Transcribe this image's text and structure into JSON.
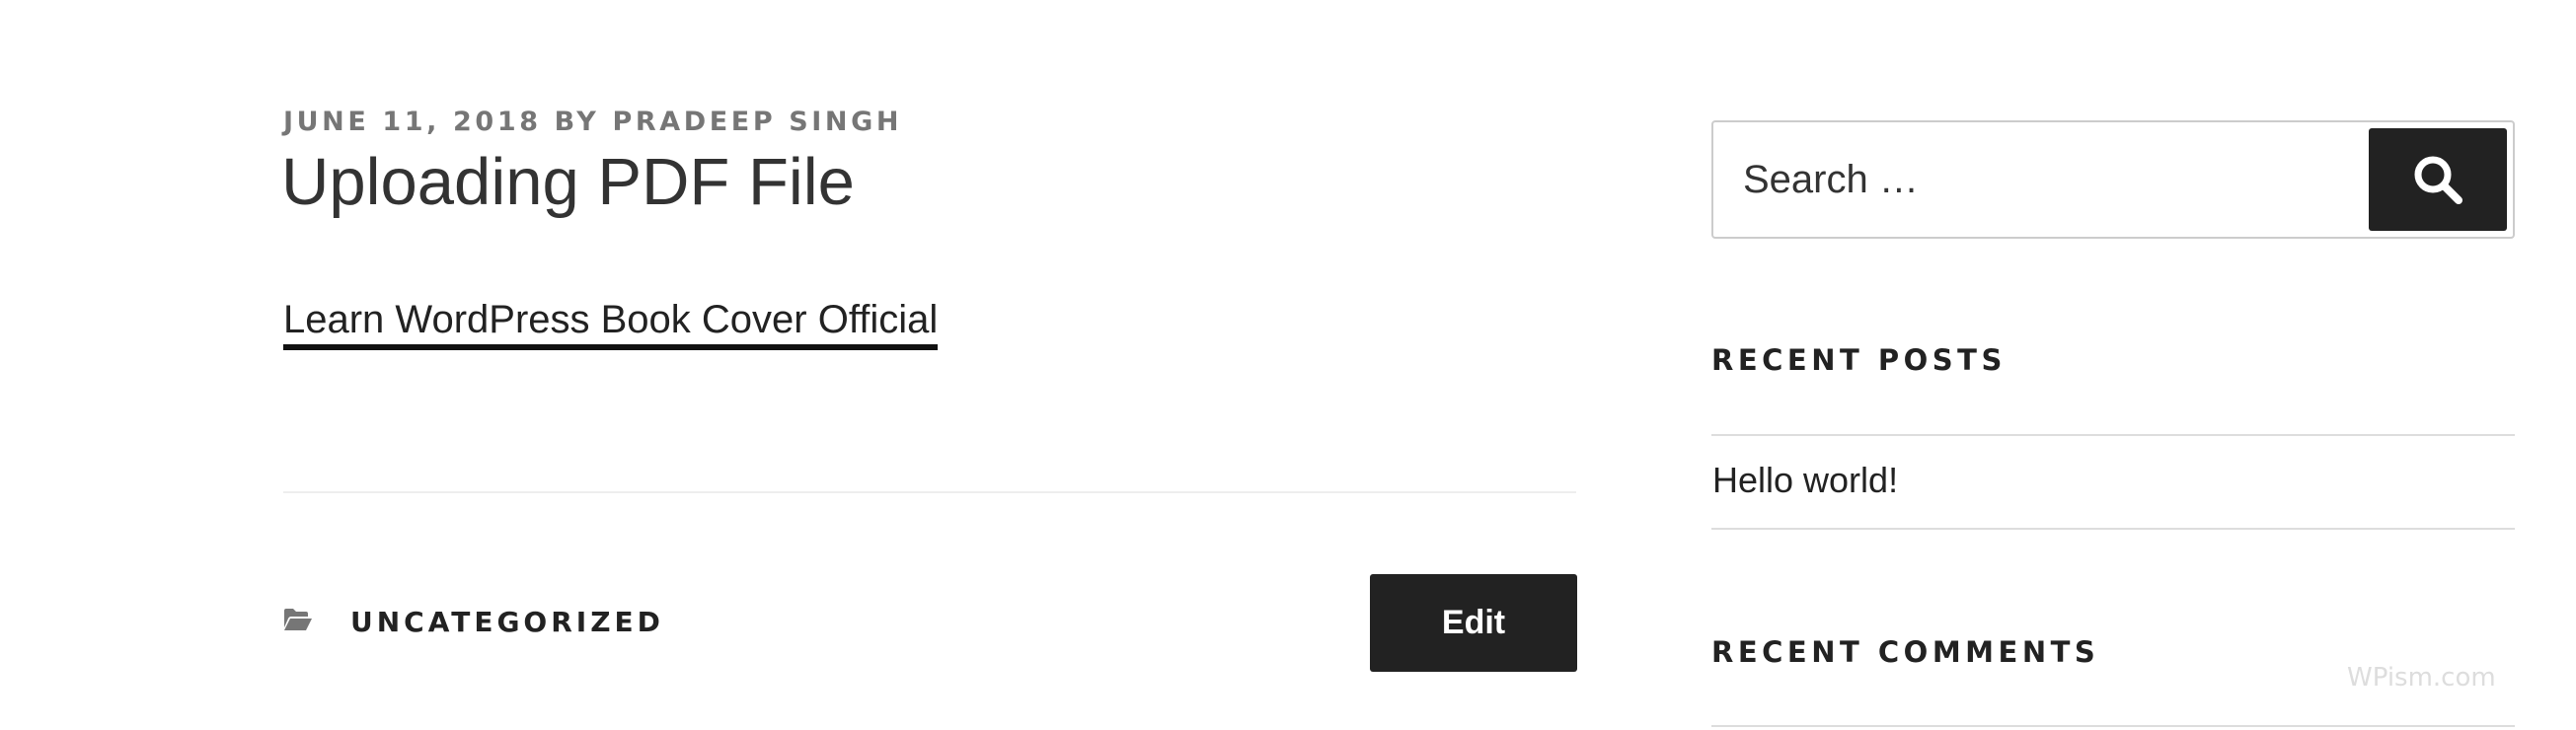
{
  "post": {
    "date": "JUNE 11, 2018",
    "by": "BY",
    "author": "PRADEEP SINGH",
    "title": "Uploading PDF File",
    "attachment_link": "Learn WordPress Book Cover Official"
  },
  "footer": {
    "category_icon": "folder-open-icon",
    "category": "UNCATEGORIZED",
    "edit_label": "Edit"
  },
  "sidebar": {
    "search": {
      "placeholder": "Search …",
      "button_icon": "search-icon"
    },
    "recent_posts": {
      "title": "RECENT POSTS",
      "items": [
        {
          "label": "Hello world!"
        }
      ]
    },
    "recent_comments": {
      "title": "RECENT COMMENTS"
    }
  },
  "watermark": "WPism.com",
  "colors": {
    "meta_text": "#767676",
    "dark_button": "#222222",
    "body_text": "#222222"
  }
}
